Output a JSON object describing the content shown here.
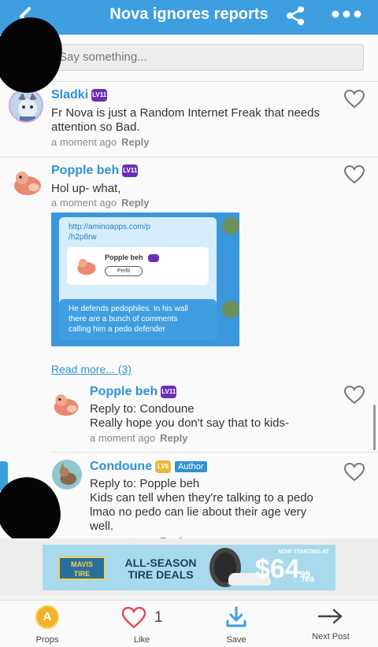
{
  "header": {
    "title": "Nova ignores reports"
  },
  "compose": {
    "placeholder": "Say something..."
  },
  "comments": [
    {
      "name": "Sladki",
      "level": "LV11",
      "text_lines": [
        "Fr Nova is just a Random Internet Freak that needs",
        "attention so Bad."
      ],
      "time": "a moment ago",
      "reply": "Reply"
    },
    {
      "name": "Popple beh",
      "level": "LV11",
      "text_lines": [
        "Hol up- what,"
      ],
      "time": "a moment ago",
      "reply": "Reply",
      "attachment": {
        "link_lines": [
          "http://aminoapps.com/p",
          "/h2p8rw"
        ],
        "card_name": "Popple beh",
        "card_button": "Perfil",
        "message_lines": [
          "He defends pedophiles. In his wall",
          "there are a bunch of comments",
          "calling him a pedo defender"
        ]
      }
    }
  ],
  "read_more": "Read more... (3)",
  "replies": [
    {
      "name": "Popple beh",
      "level": "LV11",
      "text_lines": [
        "Reply to: Condoune",
        "Really hope you don't say that to kids-"
      ],
      "time": "a moment ago",
      "reply": "Reply"
    },
    {
      "name": "Condoune",
      "level": "LV6",
      "badge": "Author",
      "text_lines": [
        "Reply to: Popple beh",
        "Kids can tell when they're talking to a pedo",
        "lmao no pedo can lie about their age very",
        "well."
      ],
      "time": "a moment ago",
      "reply": "Reply"
    }
  ],
  "ad": {
    "brand_lines": [
      "MAVIS",
      "TIRE"
    ],
    "headline_lines": [
      "ALL-SEASON",
      "TIRE DEALS"
    ],
    "starting": "NOW STARTING AT",
    "price": "$64",
    "cents": "99",
    "unit": "/ea"
  },
  "bottom_bar": {
    "props_label": "Props",
    "like_label": "Like",
    "like_count": "1",
    "save_label": "Save",
    "next_label": "Next Post"
  },
  "colors": {
    "accent": "#3d9fe0",
    "name_blue": "#2e92d4",
    "level_purple": "#6a2fb5",
    "props_gold": "#f2b22a",
    "like_red": "#e8424f"
  },
  "icons": [
    "back-arrow-icon",
    "share-icon",
    "more-icon",
    "heart-icon",
    "coin-icon",
    "download-icon",
    "arrow-right-icon"
  ]
}
